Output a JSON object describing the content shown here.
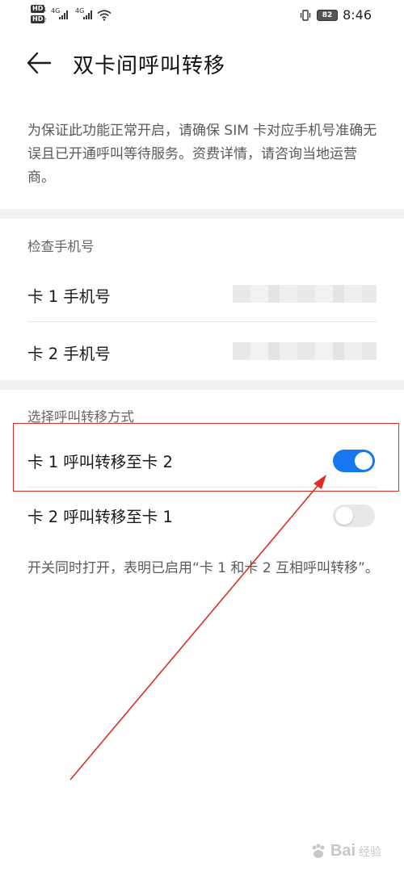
{
  "status_bar": {
    "sim1_badge": "HD",
    "sim1_index": "1",
    "sim2_badge": "HD",
    "sim2_index": "2",
    "network1": "4G",
    "network2": "4G",
    "battery": "82",
    "time": "8:46",
    "icons": [
      "signal-icon",
      "wifi-icon",
      "vibrate-icon",
      "battery-icon"
    ]
  },
  "header": {
    "back_icon": "back-arrow-icon",
    "title": "双卡间呼叫转移"
  },
  "intro_text": "为保证此功能正常开启，请确保 SIM 卡对应手机号准确无误且已开通呼叫等待服务。资费详情，请咨询当地运营商。",
  "check_numbers": {
    "heading": "检查手机号",
    "items": [
      {
        "label": "卡 1 手机号"
      },
      {
        "label": "卡 2 手机号"
      }
    ]
  },
  "forwarding": {
    "heading": "选择呼叫转移方式",
    "items": [
      {
        "label": "卡 1 呼叫转移至卡 2",
        "enabled": true
      },
      {
        "label": "卡 2 呼叫转移至卡 1",
        "enabled": false
      }
    ]
  },
  "footnote": "开关同时打开，表明已启用“卡 1 和卡 2 互相呼叫转移”。",
  "colors": {
    "accent": "#1677f0",
    "annotation": "#d9302a"
  },
  "watermark": {
    "text": "Bai",
    "suffix": "经验",
    "icon": "baidu-paw-icon"
  }
}
